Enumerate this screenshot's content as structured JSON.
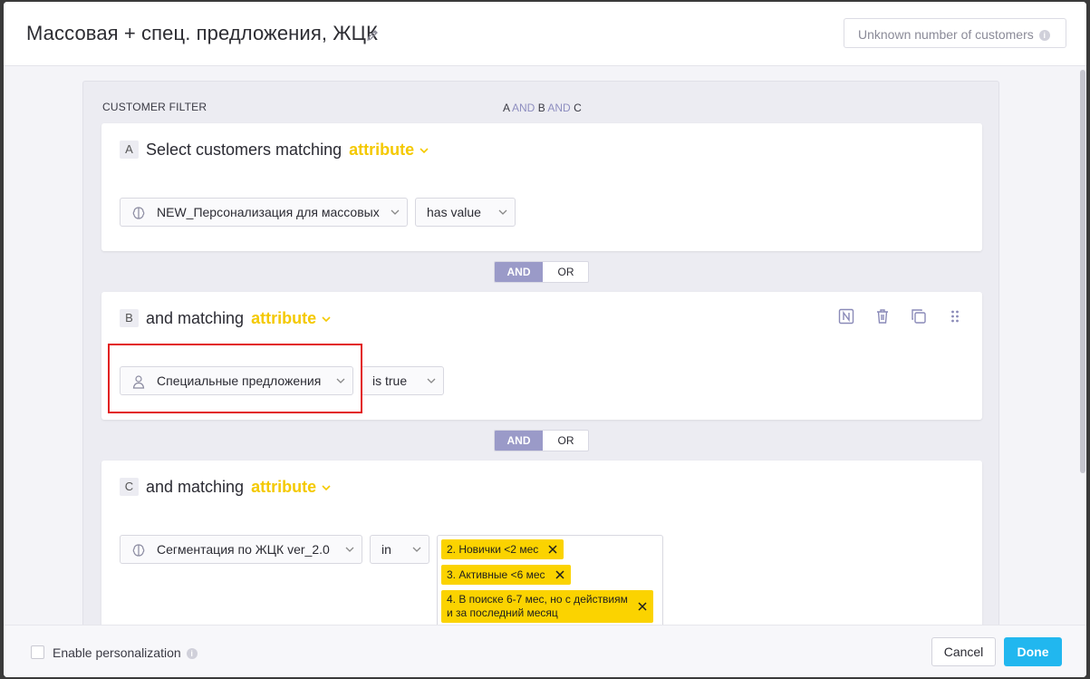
{
  "header": {
    "title": "Массовая + спец. предложения, ЖЦК",
    "customer_count": "Unknown number of customers"
  },
  "filter": {
    "label": "CUSTOMER FILTER",
    "expression": {
      "a": "A",
      "op1": "AND",
      "b": "B",
      "op2": "AND",
      "c": "C"
    },
    "blocks": [
      {
        "letter": "A",
        "title": "Select customers matching",
        "attr_link": "attribute",
        "field_icon": "brain-icon",
        "field": "NEW_Персонализация для массовых",
        "operator": "has value"
      },
      {
        "letter": "B",
        "title": "and matching",
        "attr_link": "attribute",
        "field_icon": "person-icon",
        "field": "Специальные предложения",
        "operator": "is true"
      },
      {
        "letter": "C",
        "title": "and matching",
        "attr_link": "attribute",
        "field_icon": "brain-icon",
        "field": "Сегментация по ЖЦК ver_2.0",
        "operator": "in",
        "values": [
          "2. Новички <2 мес",
          "3. Активные <6 мес",
          "4. В поиске 6-7 мес, но с действиям",
          "и за последний месяц"
        ]
      }
    ],
    "connectors": [
      {
        "and": "AND",
        "or": "OR",
        "selected": "AND"
      },
      {
        "and": "AND",
        "or": "OR",
        "selected": "AND"
      }
    ]
  },
  "footer": {
    "enable_personalization": "Enable personalization",
    "cancel": "Cancel",
    "done": "Done"
  },
  "colors": {
    "accent_attribute": "#f4c900",
    "and_selected": "#9a9ac8",
    "done_button": "#21b7ef",
    "tag_background": "#fbd300",
    "highlight_border": "#e21d1d"
  }
}
